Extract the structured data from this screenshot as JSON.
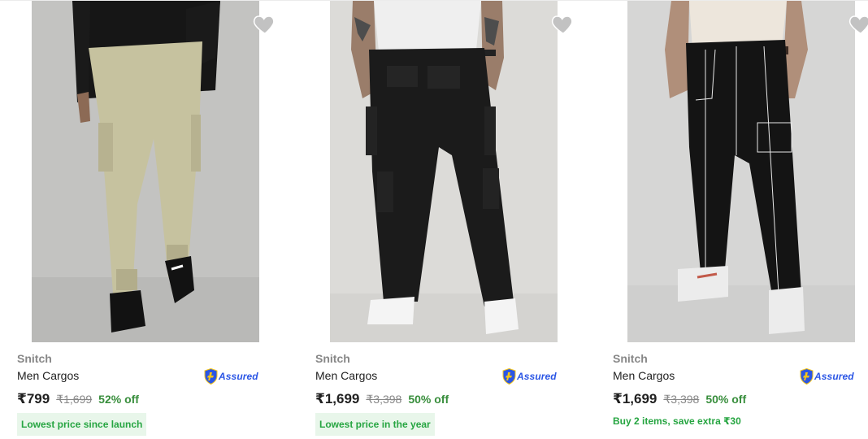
{
  "products": [
    {
      "brand": "Snitch",
      "title": "Men Cargos",
      "assured_label": "Assured",
      "price": "₹799",
      "mrp": "₹1,699",
      "discount": "52% off",
      "tag": "Lowest price since launch",
      "pant_color": "#c6c29f",
      "backdrop_color": "#c3c3c1"
    },
    {
      "brand": "Snitch",
      "title": "Men Cargos",
      "assured_label": "Assured",
      "price": "₹1,699",
      "mrp": "₹3,398",
      "discount": "50% off",
      "tag": "Lowest price in the year",
      "pant_color": "#1b1b1b",
      "backdrop_color": "#dcdbd8"
    },
    {
      "brand": "Snitch",
      "title": "Men Cargos",
      "assured_label": "Assured",
      "price": "₹1,699",
      "mrp": "₹3,398",
      "discount": "50% off",
      "offer": "Buy 2 items, save extra ₹30",
      "pant_color": "#141414",
      "backdrop_color": "#d6d6d5"
    }
  ],
  "icons": {
    "wishlist": "heart-icon",
    "assured": "shield-plus-icon"
  },
  "colors": {
    "discount_green": "#388e3c",
    "tag_green": "#26a541",
    "tag_bg": "#e8f6ea",
    "assured_blue": "#2a55e5",
    "heart_grey": "#c2c2c2"
  }
}
